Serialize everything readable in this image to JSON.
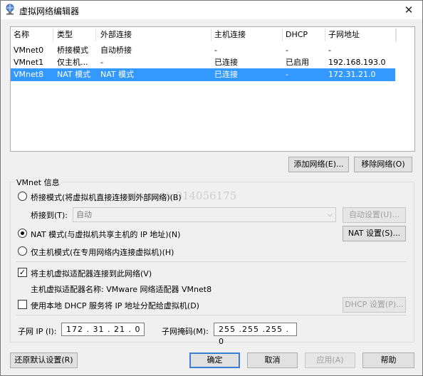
{
  "window": {
    "title": "虚拟网络编辑器",
    "close_glyph": "✕"
  },
  "list": {
    "headers": [
      "名称",
      "类型",
      "外部连接",
      "主机连接",
      "DHCP",
      "子网地址"
    ],
    "rows": [
      [
        "VMnet0",
        "桥接模式",
        "自动桥接",
        "-",
        "-",
        "-"
      ],
      [
        "VMnet1",
        "仅主机...",
        "-",
        "已连接",
        "已启用",
        "192.168.193.0"
      ],
      [
        "VMnet8",
        "NAT 模式",
        "NAT 模式",
        "已连接",
        "-",
        "172.31.21.0"
      ]
    ],
    "selected_index": 2
  },
  "buttons": {
    "add_network": "添加网络(E)...",
    "remove_network": "移除网络(O)",
    "auto_settings": "自动设置(U)...",
    "nat_settings": "NAT 设置(S)...",
    "dhcp_settings": "DHCP 设置(P)...",
    "restore_defaults": "还原默认设置(R)",
    "ok": "确定",
    "cancel": "取消",
    "apply": "应用(A)",
    "help": "帮助"
  },
  "vmnet_info": {
    "group_title": "VMnet 信息",
    "bridged_label": "桥接模式(将虚拟机直接连接到外部网络)(B)",
    "bridged_to_label": "桥接到(T):",
    "bridged_to_value": "自动",
    "nat_label": "NAT 模式(与虚拟机共享主机的 IP 地址)(N)",
    "hostonly_label": "仅主机模式(在专用网络内连接虚拟机)(H)",
    "selected_mode": "nat",
    "connect_adapter_label": "将主机虚拟适配器连接到此网络(V)",
    "connect_adapter_checked": true,
    "adapter_name_label": "主机虚拟适配器名称: VMware 网络适配器 VMnet8",
    "use_dhcp_label": "使用本地 DHCP 服务将 IP 地址分配给虚拟机(D)",
    "use_dhcp_checked": false,
    "subnet_ip_label": "子网 IP (I):",
    "subnet_ip_value": "172 . 31 . 21 . 0",
    "subnet_mask_label": "子网掩码(M):",
    "subnet_mask_value": "255 .255 .255 . 0"
  },
  "watermark": "csdn.net/u014056175",
  "icons": {
    "title": "network-globe-icon",
    "combo": "chevron-down-icon",
    "check": "checkmark-icon"
  },
  "colors": {
    "selection": "#3399ff",
    "default_button_border": "#3a7fd5"
  }
}
